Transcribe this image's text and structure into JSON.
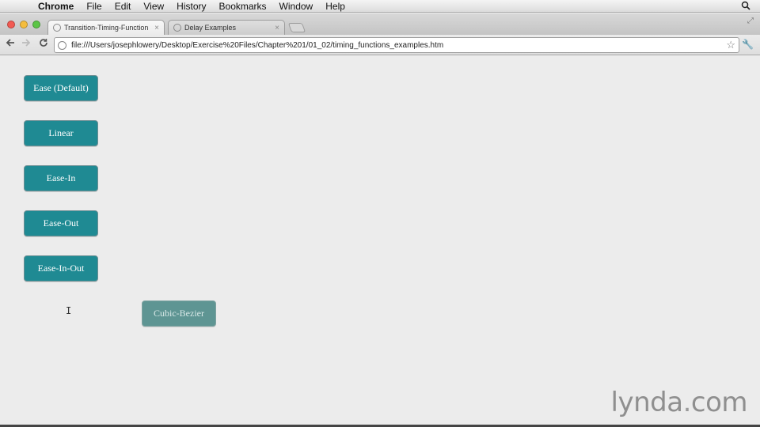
{
  "menubar": {
    "app": "Chrome",
    "items": [
      "File",
      "Edit",
      "View",
      "History",
      "Bookmarks",
      "Window",
      "Help"
    ]
  },
  "tabs": [
    {
      "label": "Transition-Timing-Function",
      "close": "×"
    },
    {
      "label": "Delay Examples",
      "close": "×"
    }
  ],
  "toolbar": {
    "url": "file:///Users/josephlowery/Desktop/Exercise%20Files/Chapter%201/01_02/timing_functions_examples.htm"
  },
  "icons": {
    "apple": "apple-icon",
    "spotlight": "search-icon",
    "back": "back-arrow-icon",
    "forward": "forward-arrow-icon",
    "reload": "reload-icon",
    "bookmark": "star-icon",
    "settings": "wrench-icon"
  },
  "buttons": {
    "ease": "Ease (Default)",
    "linear": "Linear",
    "ease_in": "Ease-In",
    "ease_out": "Ease-Out",
    "ease_in_out": "Ease-In-Out",
    "cubic_bezier": "Cubic-Bezier"
  },
  "watermark": {
    "brand": "lynda",
    "dot": ".",
    "tld": "com"
  },
  "colors": {
    "button": "#1f8a93",
    "button_faded": "#5e9593"
  }
}
